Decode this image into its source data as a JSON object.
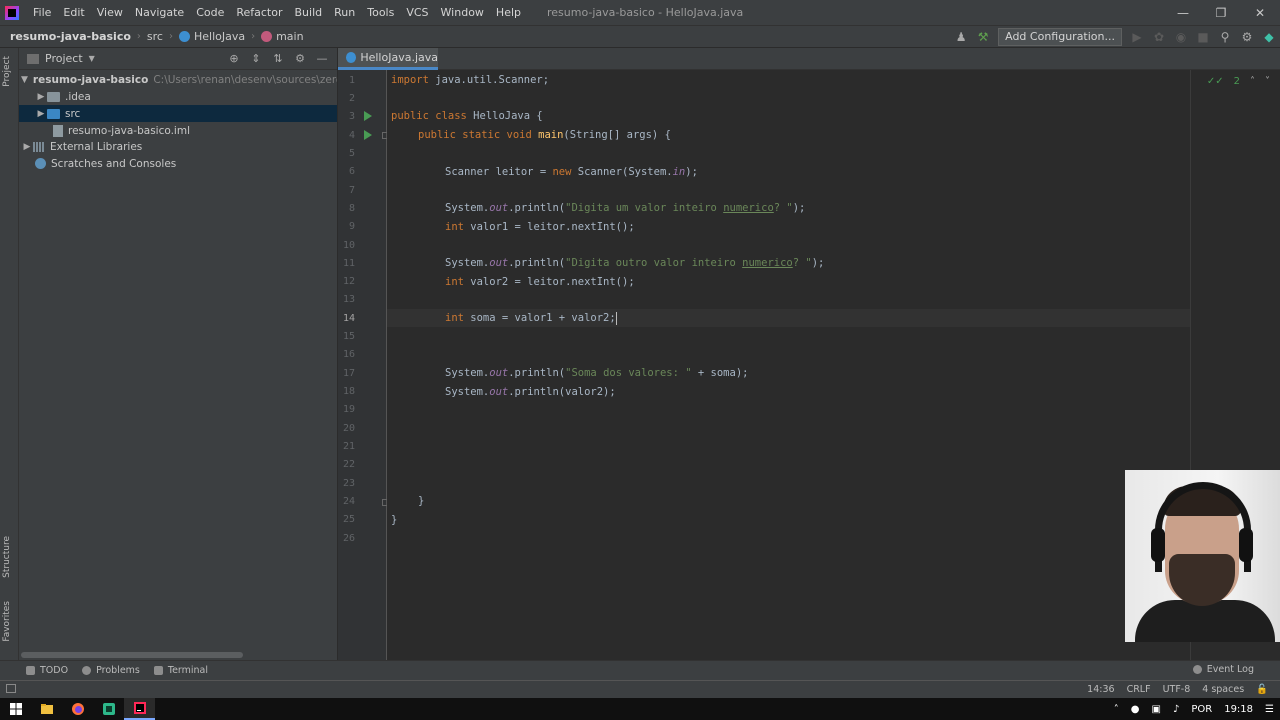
{
  "menubar": {
    "items": [
      "File",
      "Edit",
      "View",
      "Navigate",
      "Code",
      "Refactor",
      "Build",
      "Run",
      "Tools",
      "VCS",
      "Window",
      "Help"
    ],
    "window_title": "resumo-java-basico - HelloJava.java"
  },
  "navbar": {
    "crumbs": [
      "resumo-java-basico",
      "src",
      "HelloJava",
      "main"
    ],
    "add_configuration": "Add Configuration..."
  },
  "project_panel": {
    "title": "Project",
    "tree": [
      {
        "label": "resumo-java-basico",
        "path": "C:\\Users\\renan\\desenv\\sources\\zero_micro"
      },
      {
        "label": ".idea"
      },
      {
        "label": "src"
      },
      {
        "label": "resumo-java-basico.iml"
      },
      {
        "label": "External Libraries"
      },
      {
        "label": "Scratches and Consoles"
      }
    ]
  },
  "left_stripe": {
    "project": "Project",
    "structure": "Structure",
    "favorites": "Favorites"
  },
  "editor": {
    "tab": "HelloJava.java",
    "inspections": "2",
    "line_numbers": [
      "1",
      "2",
      "3",
      "4",
      "5",
      "6",
      "7",
      "8",
      "9",
      "10",
      "11",
      "12",
      "13",
      "14",
      "15",
      "16",
      "17",
      "18",
      "19",
      "20",
      "21",
      "22",
      "23",
      "24",
      "25",
      "26"
    ],
    "current_line": "14",
    "code": {
      "l1_kw": "import",
      "l1_rest": " java.util.Scanner;",
      "l3_kw": "public class",
      "l3_rest": " HelloJava {",
      "l4_kw": "public static void",
      "l4_fn": "main",
      "l4_rest": "(String[] args) {",
      "l6_a": "Scanner leitor = ",
      "l6_kw": "new",
      "l6_b": " Scanner(System.",
      "l6_fld": "in",
      "l6_c": ");",
      "l8_a": "System.",
      "l8_fld": "out",
      "l8_b": ".println(",
      "l8_s1": "\"Digita um valor inteiro ",
      "l8_typo": "numerico",
      "l8_s2": "? \"",
      "l8_c": ");",
      "l9_kw": "int",
      "l9_rest": " valor1 = leitor.nextInt();",
      "l11_a": "System.",
      "l11_fld": "out",
      "l11_b": ".println(",
      "l11_s1": "\"Digita outro valor inteiro ",
      "l11_typo": "numerico",
      "l11_s2": "? \"",
      "l11_c": ");",
      "l12_kw": "int",
      "l12_rest": " valor2 = leitor.nextInt();",
      "l14_kw": "int",
      "l14_rest": " soma = valor1 + valor2;",
      "l17_a": "System.",
      "l17_fld": "out",
      "l17_b": ".println(",
      "l17_s": "\"Soma dos valores: \"",
      "l17_c": " + soma);",
      "l18_a": "System.",
      "l18_fld": "out",
      "l18_b": ".println(valor2);",
      "l24": "}",
      "l25": "}"
    }
  },
  "bottombar": {
    "todo": "TODO",
    "problems": "Problems",
    "terminal": "Terminal",
    "event_log": "Event Log"
  },
  "statusbar": {
    "position": "14:36",
    "line_sep": "CRLF",
    "encoding": "UTF-8",
    "indent": "4 spaces"
  },
  "taskbar": {
    "language": "POR",
    "time": "19:18"
  },
  "colors": {
    "keyword": "#cc7832",
    "string": "#6a8759",
    "field": "#9876aa",
    "function": "#ffc66d",
    "accent": "#4a88c7"
  }
}
